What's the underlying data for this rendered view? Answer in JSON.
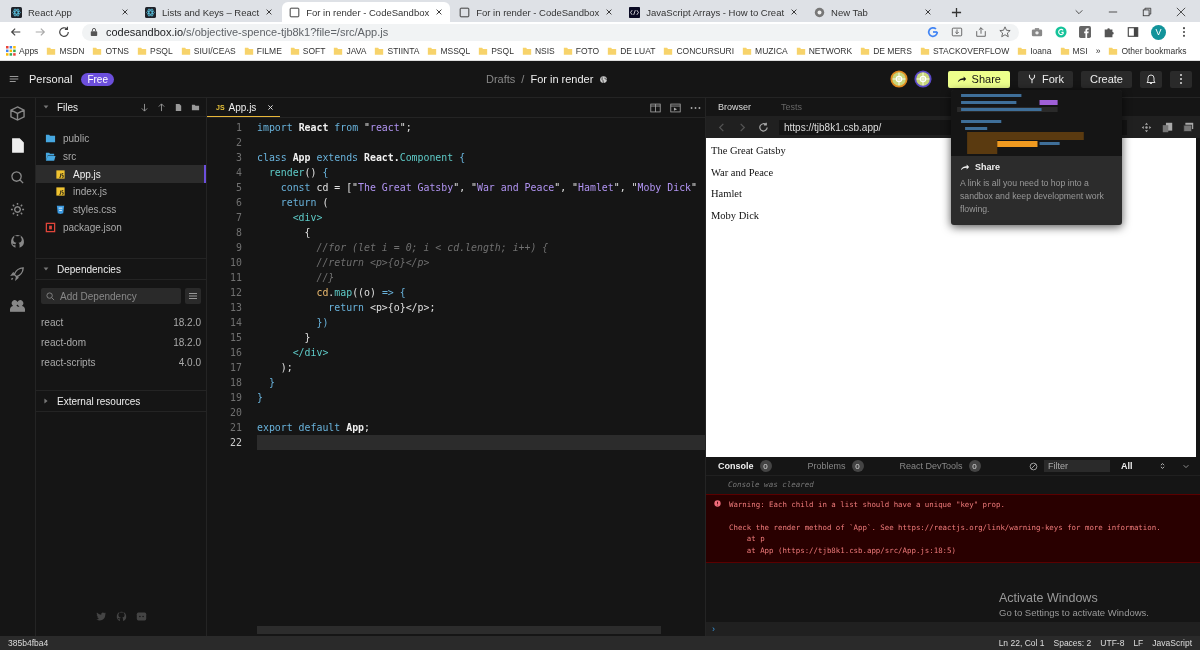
{
  "browser_tabs": [
    {
      "title": "React App",
      "selected": false
    },
    {
      "title": "Lists and Keys – React",
      "selected": false
    },
    {
      "title": "For in render - CodeSandbox",
      "selected": true
    },
    {
      "title": "For in render - CodeSandbox",
      "selected": false
    },
    {
      "title": "JavaScript Arrays - How to Creat",
      "selected": false
    },
    {
      "title": "New Tab",
      "selected": false
    }
  ],
  "address_bar": {
    "host": "codesandbox.io",
    "path": "/s/objective-spence-tjb8k1?file=/src/App.js",
    "profile_initial": "V"
  },
  "bookmarks": {
    "apps": "Apps",
    "folders": [
      "MSDN",
      "OTNS",
      "PSQL",
      "SIUI/CEAS",
      "FILME",
      "SOFT",
      "JAVA",
      "STIINTA",
      "MSSQL",
      "PSQL",
      "NSIS",
      "FOTO",
      "DE LUAT",
      "CONCURSURI",
      "MUZICA",
      "NETWORK",
      "DE MERS",
      "STACKOVERFLOW",
      "Ioana",
      "MSI"
    ],
    "more": "»",
    "other": "Other bookmarks"
  },
  "header": {
    "workspace": "Personal",
    "plan": "Free",
    "breadcrumb": [
      "Drafts",
      "For in render"
    ],
    "separator": "/",
    "buttons": {
      "share": "Share",
      "fork": "Fork",
      "create": "Create"
    }
  },
  "activity_bar": [
    {
      "selected": false
    },
    {
      "selected": true
    },
    {
      "selected": false
    },
    {
      "selected": false
    },
    {
      "selected": false
    },
    {
      "selected": false
    },
    {
      "selected": false
    }
  ],
  "files": {
    "title": "Files",
    "tree": [
      {
        "name": "public",
        "kind": "folder",
        "expanded": false,
        "selected": false
      },
      {
        "name": "src",
        "kind": "folder",
        "expanded": true,
        "selected": false,
        "children": [
          {
            "name": "App.js",
            "kind": "js",
            "selected": true
          },
          {
            "name": "index.js",
            "kind": "js",
            "selected": false
          },
          {
            "name": "styles.css",
            "kind": "css",
            "selected": false
          }
        ]
      },
      {
        "name": "package.json",
        "kind": "json",
        "selected": false
      }
    ]
  },
  "dependencies": {
    "title": "Dependencies",
    "expanded": true,
    "search": {
      "placeholder": "Add Dependency"
    },
    "items": [
      {
        "name": "react",
        "version": "18.2.0"
      },
      {
        "name": "react-dom",
        "version": "18.2.0"
      },
      {
        "name": "react-scripts",
        "version": "4.0.0"
      }
    ]
  },
  "external_resources": {
    "title": "External resources",
    "expanded": false
  },
  "editor": {
    "tab": {
      "badge": "JS",
      "name": "App.js"
    },
    "lines": [
      {
        "n": "1",
        "current": false,
        "tokens": [
          {
            "kind": "kw",
            "text": "import "
          },
          {
            "kind": "id",
            "text": "React "
          },
          {
            "kind": "kw",
            "text": "from "
          },
          {
            "kind": "p",
            "text": "\""
          },
          {
            "kind": "str",
            "text": "react"
          },
          {
            "kind": "p",
            "text": "\";"
          }
        ]
      },
      {
        "n": "2",
        "current": false
      },
      {
        "n": "3",
        "current": false,
        "tokens": [
          {
            "kind": "kw",
            "text": "class "
          },
          {
            "kind": "id",
            "text": "App "
          },
          {
            "kind": "kw",
            "text": "extends "
          },
          {
            "kind": "id",
            "text": "React."
          },
          {
            "kind": "ty",
            "text": "Component "
          },
          {
            "kind": "kw",
            "text": "{"
          }
        ]
      },
      {
        "n": "4",
        "current": false,
        "tokens": [
          {
            "kind": "ty",
            "text": "  render"
          },
          {
            "kind": "p",
            "text": "() "
          },
          {
            "kind": "kw",
            "text": "{"
          }
        ]
      },
      {
        "n": "5",
        "current": false,
        "tokens": [
          {
            "kind": "kw",
            "text": "    const "
          },
          {
            "kind": "p",
            "text": "cd = [\""
          },
          {
            "kind": "str",
            "text": "The Great Gatsby"
          },
          {
            "kind": "p",
            "text": "\", \""
          },
          {
            "kind": "str",
            "text": "War and Peace"
          },
          {
            "kind": "p",
            "text": "\", \""
          },
          {
            "kind": "str",
            "text": "Hamlet"
          },
          {
            "kind": "p",
            "text": "\", \""
          },
          {
            "kind": "str",
            "text": "Moby Dick"
          },
          {
            "kind": "p",
            "text": "\""
          }
        ]
      },
      {
        "n": "6",
        "current": false,
        "tokens": [
          {
            "kind": "kw",
            "text": "    return "
          },
          {
            "kind": "p",
            "text": "("
          }
        ]
      },
      {
        "n": "7",
        "current": false,
        "tokens": [
          {
            "kind": "ty",
            "text": "      <div>"
          }
        ]
      },
      {
        "n": "8",
        "current": false,
        "tokens": [
          {
            "kind": "p",
            "text": "        {"
          }
        ]
      },
      {
        "n": "9",
        "current": false,
        "tokens": [
          {
            "kind": "com",
            "text": "          //for (let i = 0; i < cd.length; i++) {"
          }
        ]
      },
      {
        "n": "10",
        "current": false,
        "tokens": [
          {
            "kind": "com",
            "text": "          //return <p>{o}</p>"
          }
        ]
      },
      {
        "n": "11",
        "current": false,
        "tokens": [
          {
            "kind": "com",
            "text": "          //}"
          }
        ]
      },
      {
        "n": "12",
        "current": false,
        "tokens": [
          {
            "kind": "var",
            "text": "          cd"
          },
          {
            "kind": "p",
            "text": "."
          },
          {
            "kind": "ty",
            "text": "map"
          },
          {
            "kind": "p",
            "text": "((o) "
          },
          {
            "kind": "kw",
            "text": "=> {"
          }
        ]
      },
      {
        "n": "13",
        "current": false,
        "tokens": [
          {
            "kind": "kw",
            "text": "            return "
          },
          {
            "kind": "p",
            "text": "<p>{o}</p>;"
          }
        ]
      },
      {
        "n": "14",
        "current": false,
        "tokens": [
          {
            "kind": "kw",
            "text": "          })"
          }
        ]
      },
      {
        "n": "15",
        "current": false,
        "tokens": [
          {
            "kind": "p",
            "text": "        }"
          }
        ]
      },
      {
        "n": "16",
        "current": false,
        "tokens": [
          {
            "kind": "ty",
            "text": "      </div>"
          }
        ]
      },
      {
        "n": "17",
        "current": false,
        "tokens": [
          {
            "kind": "p",
            "text": "    );"
          }
        ]
      },
      {
        "n": "18",
        "current": false,
        "tokens": [
          {
            "kind": "kw",
            "text": "  }"
          }
        ]
      },
      {
        "n": "19",
        "current": false,
        "tokens": [
          {
            "kind": "kw",
            "text": "}"
          }
        ]
      },
      {
        "n": "20",
        "current": false
      },
      {
        "n": "21",
        "current": false,
        "tokens": [
          {
            "kind": "kw",
            "text": "export default "
          },
          {
            "kind": "id",
            "text": "App"
          },
          {
            "kind": "p",
            "text": ";"
          }
        ]
      },
      {
        "n": "22",
        "current": true
      }
    ]
  },
  "preview": {
    "tabs": [
      {
        "label": "Browser",
        "selected": true
      },
      {
        "label": "Tests",
        "selected": false
      }
    ],
    "url": "https://tjb8k1.csb.app/",
    "content": [
      "The Great Gatsby",
      "War and Peace",
      "Hamlet",
      "Moby Dick"
    ]
  },
  "share_popover": {
    "title": "Share",
    "text": "A link is all you need to hop into a sandbox and keep development work flowing."
  },
  "console": {
    "tabs": [
      {
        "label": "Console",
        "count": "0",
        "selected": true
      },
      {
        "label": "Problems",
        "count": "0",
        "selected": false
      },
      {
        "label": "React DevTools",
        "count": "0",
        "selected": false
      }
    ],
    "filter": {
      "placeholder": "Filter"
    },
    "level": "All",
    "messages": [
      {
        "kind": "info",
        "text": "Console was cleared"
      },
      {
        "kind": "error",
        "text": "Warning: Each child in a list should have a unique \"key\" prop.",
        "details": [
          "Check the render method of `App`. See https://reactjs.org/link/warning-keys for more information.",
          "    at p",
          "    at App (https://tjb8k1.csb.app/src/App.js:18:5)"
        ]
      }
    ],
    "prompt": "›"
  },
  "os_notice": {
    "title": "Activate Windows",
    "text": "Go to Settings to activate Windows."
  },
  "status_bar": {
    "commit": "385b4fba4",
    "items": [
      "Ln 22, Col 1",
      "Spaces: 2",
      "UTF-8",
      "LF",
      "JavaScript"
    ]
  }
}
